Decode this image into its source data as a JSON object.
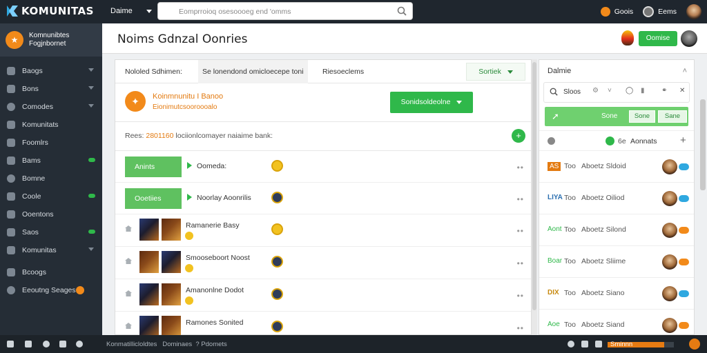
{
  "app": {
    "name": "KOMUNITAS"
  },
  "topbar": {
    "menu_label": "Daime",
    "search_placeholder": "Eomprroioq osesoooeg end 'omms",
    "user1": "Goois",
    "user2": "Eems"
  },
  "sidebar": {
    "header_line1": "Komnunibtes",
    "header_line2": "Fogjnbornet",
    "items": [
      {
        "label": "Baogs"
      },
      {
        "label": "Bons"
      },
      {
        "label": "Comodes"
      },
      {
        "label": "Komunitats"
      },
      {
        "label": "Foomlrs"
      },
      {
        "label": "Bams"
      },
      {
        "label": "Bomne"
      },
      {
        "label": "Coole"
      },
      {
        "label": "Ooentons"
      },
      {
        "label": "Saos"
      },
      {
        "label": "Komunitas"
      },
      {
        "label": "Bcoogs"
      },
      {
        "label": "Eeoutng Seages"
      }
    ]
  },
  "page": {
    "title": "Noims Gdnzal Oonries",
    "header_button": "Oomise"
  },
  "panel": {
    "tab1": "Nololed Sdhimen:",
    "tab2": "Se lonendond omicloecepe toni",
    "tab3": "Riesoeclems",
    "sort_label": "Sortiek",
    "promo_title": "Koinmnunitu I Banoo",
    "promo_sub": "Eionimutcsooroooalo",
    "promo_button": "Sonidsoldeolne",
    "stats_prefix": "Rees:",
    "stats_number": "2801160",
    "stats_rest": "lociionlcomayer naiaime bank:",
    "rows": [
      {
        "box": "Anints",
        "text": "Oomeda:"
      },
      {
        "box": "Ooetiies",
        "text": "Noorlay Aoonrilis"
      },
      {
        "text": "Ramanerie Basy"
      },
      {
        "text": "Smooseboort Noost"
      },
      {
        "text": "Amanonlne Dodot"
      },
      {
        "text": "Ramones Sonited"
      }
    ]
  },
  "right": {
    "title": "Dalmie",
    "tool_label": "Sloos",
    "green_label": "Sone",
    "green_btn1": "Sone",
    "green_btn2": "Sane",
    "sub_label": "Aonnats",
    "sub_num": "6e",
    "items": [
      {
        "tag": "AS",
        "label": "Aboetz Sldoid",
        "tagcolor": "#e37a10"
      },
      {
        "tag": "LIYA",
        "label": "Aboetz Oiliod",
        "tagcolor": "#2b6fb0"
      },
      {
        "tag": "Aont",
        "label": "Aboetz Silond",
        "tagcolor": "#2fb84a"
      },
      {
        "tag": "Boar",
        "label": "Aboetz Sliime",
        "tagcolor": "#2fb84a"
      },
      {
        "tag": "DIX",
        "label": "Aboetz Siano",
        "tagcolor": "#c88a10"
      },
      {
        "tag": "Aoe",
        "label": "Aboetz Siand",
        "tagcolor": "#2fb84a"
      }
    ],
    "mid_word": "Too"
  },
  "bottombar": {
    "text1": "Konmatillicloldtes",
    "text2": "Dominaes",
    "text3": "Pdomets",
    "right_label": "Sminnn",
    "progress": 0.85
  },
  "colors": {
    "accent_green": "#2fb84a",
    "accent_orange": "#f28a1a",
    "sidebar_bg": "#252d36"
  }
}
